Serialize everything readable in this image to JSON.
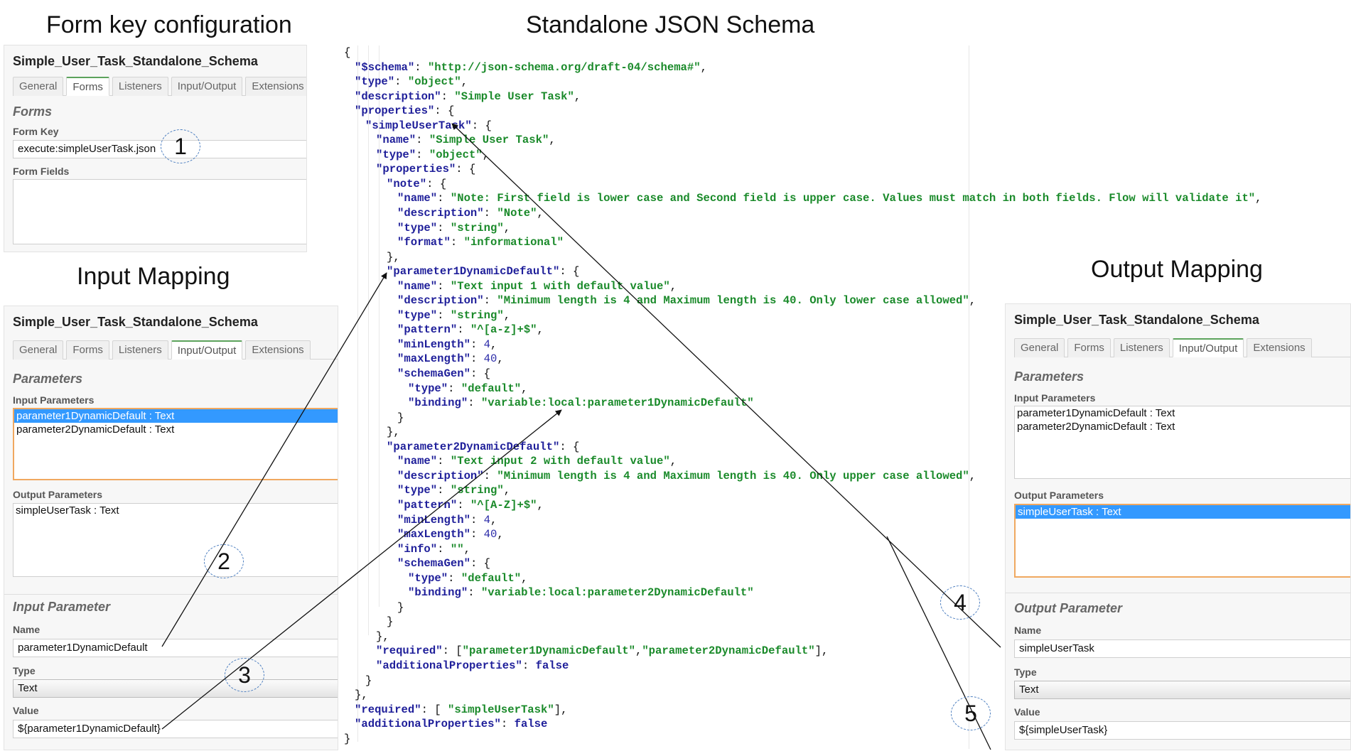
{
  "headings": {
    "form_key": "Form key configuration",
    "schema": "Standalone JSON Schema",
    "input_mapping": "Input Mapping",
    "output_mapping": "Output Mapping"
  },
  "panel_title": "Simple_User_Task_Standalone_Schema",
  "tabs": [
    "General",
    "Forms",
    "Listeners",
    "Input/Output",
    "Extensions"
  ],
  "forms_panel": {
    "active_tab": "Forms",
    "section": "Forms",
    "form_key_label": "Form Key",
    "form_key_value": "execute:simpleUserTask.json",
    "form_fields_label": "Form Fields"
  },
  "input_panel": {
    "active_tab": "Input/Output",
    "section": "Parameters",
    "input_params_label": "Input Parameters",
    "input_params": [
      "parameter1DynamicDefault : Text",
      "parameter2DynamicDefault : Text"
    ],
    "output_params_label": "Output Parameters",
    "output_params": [
      "simpleUserTask : Text"
    ],
    "detail_section": "Input Parameter",
    "name_label": "Name",
    "name_value": "parameter1DynamicDefault",
    "type_label": "Type",
    "type_value": "Text",
    "value_label": "Value",
    "value_value": "${parameter1DynamicDefault}"
  },
  "output_panel": {
    "active_tab": "Input/Output",
    "section": "Parameters",
    "input_params_label": "Input Parameters",
    "input_params": [
      "parameter1DynamicDefault : Text",
      "parameter2DynamicDefault : Text"
    ],
    "output_params_label": "Output Parameters",
    "output_params": [
      "simpleUserTask : Text"
    ],
    "detail_section": "Output Parameter",
    "name_label": "Name",
    "name_value": "simpleUserTask",
    "type_label": "Type",
    "type_value": "Text",
    "value_label": "Value",
    "value_value": "${simpleUserTask}"
  },
  "callouts": [
    "1",
    "2",
    "3",
    "4",
    "5"
  ],
  "schema_lines": [
    [
      0,
      [
        [
          "p",
          "{"
        ]
      ]
    ],
    [
      1,
      [
        [
          "k",
          "\"$schema\""
        ],
        [
          "p",
          ": "
        ],
        [
          "s",
          "\"http://json-schema.org/draft-04/schema#\""
        ],
        [
          "p",
          ","
        ]
      ]
    ],
    [
      1,
      [
        [
          "k",
          "\"type\""
        ],
        [
          "p",
          ": "
        ],
        [
          "s",
          "\"object\""
        ],
        [
          "p",
          ","
        ]
      ]
    ],
    [
      1,
      [
        [
          "k",
          "\"description\""
        ],
        [
          "p",
          ": "
        ],
        [
          "s",
          "\"Simple User Task\""
        ],
        [
          "p",
          ","
        ]
      ]
    ],
    [
      1,
      [
        [
          "k",
          "\"properties\""
        ],
        [
          "p",
          ": {"
        ]
      ]
    ],
    [
      2,
      [
        [
          "k",
          "\"simpleUserTask\""
        ],
        [
          "p",
          ": {"
        ]
      ]
    ],
    [
      3,
      [
        [
          "k",
          "\"name\""
        ],
        [
          "p",
          ": "
        ],
        [
          "s",
          "\"Simple User Task\""
        ],
        [
          "p",
          ","
        ]
      ]
    ],
    [
      3,
      [
        [
          "k",
          "\"type\""
        ],
        [
          "p",
          ": "
        ],
        [
          "s",
          "\"object\""
        ],
        [
          "p",
          ","
        ]
      ]
    ],
    [
      3,
      [
        [
          "k",
          "\"properties\""
        ],
        [
          "p",
          ": {"
        ]
      ]
    ],
    [
      4,
      [
        [
          "k",
          "\"note\""
        ],
        [
          "p",
          ": {"
        ]
      ]
    ],
    [
      5,
      [
        [
          "k",
          "\"name\""
        ],
        [
          "p",
          ": "
        ],
        [
          "s",
          "\"Note: First field is lower case and Second field is upper case. Values must match in both fields. Flow will validate it\""
        ],
        [
          "p",
          ","
        ]
      ]
    ],
    [
      5,
      [
        [
          "k",
          "\"description\""
        ],
        [
          "p",
          ": "
        ],
        [
          "s",
          "\"Note\""
        ],
        [
          "p",
          ","
        ]
      ]
    ],
    [
      5,
      [
        [
          "k",
          "\"type\""
        ],
        [
          "p",
          ": "
        ],
        [
          "s",
          "\"string\""
        ],
        [
          "p",
          ","
        ]
      ]
    ],
    [
      5,
      [
        [
          "k",
          "\"format\""
        ],
        [
          "p",
          ": "
        ],
        [
          "s",
          "\"informational\""
        ]
      ]
    ],
    [
      4,
      [
        [
          "p",
          "},"
        ]
      ]
    ],
    [
      4,
      [
        [
          "k",
          "\"parameter1DynamicDefault\""
        ],
        [
          "p",
          ": {"
        ]
      ]
    ],
    [
      5,
      [
        [
          "k",
          "\"name\""
        ],
        [
          "p",
          ": "
        ],
        [
          "s",
          "\"Text input 1 with default value\""
        ],
        [
          "p",
          ","
        ]
      ]
    ],
    [
      5,
      [
        [
          "k",
          "\"description\""
        ],
        [
          "p",
          ": "
        ],
        [
          "s",
          "\"Minimum length is 4 and Maximum length is 40. Only lower case allowed\""
        ],
        [
          "p",
          ","
        ]
      ]
    ],
    [
      5,
      [
        [
          "k",
          "\"type\""
        ],
        [
          "p",
          ": "
        ],
        [
          "s",
          "\"string\""
        ],
        [
          "p",
          ","
        ]
      ]
    ],
    [
      5,
      [
        [
          "k",
          "\"pattern\""
        ],
        [
          "p",
          ": "
        ],
        [
          "s",
          "\"^[a-z]+$\""
        ],
        [
          "p",
          ","
        ]
      ]
    ],
    [
      5,
      [
        [
          "k",
          "\"minLength\""
        ],
        [
          "p",
          ": "
        ],
        [
          "n",
          "4"
        ],
        [
          "p",
          ","
        ]
      ]
    ],
    [
      5,
      [
        [
          "k",
          "\"maxLength\""
        ],
        [
          "p",
          ": "
        ],
        [
          "n",
          "40"
        ],
        [
          "p",
          ","
        ]
      ]
    ],
    [
      5,
      [
        [
          "k",
          "\"schemaGen\""
        ],
        [
          "p",
          ": {"
        ]
      ]
    ],
    [
      6,
      [
        [
          "k",
          "\"type\""
        ],
        [
          "p",
          ": "
        ],
        [
          "s",
          "\"default\""
        ],
        [
          "p",
          ","
        ]
      ]
    ],
    [
      6,
      [
        [
          "k",
          "\"binding\""
        ],
        [
          "p",
          ": "
        ],
        [
          "s",
          "\"variable:local:parameter1DynamicDefault\""
        ]
      ]
    ],
    [
      5,
      [
        [
          "p",
          "}"
        ]
      ]
    ],
    [
      4,
      [
        [
          "p",
          "},"
        ]
      ]
    ],
    [
      4,
      [
        [
          "k",
          "\"parameter2DynamicDefault\""
        ],
        [
          "p",
          ": {"
        ]
      ]
    ],
    [
      5,
      [
        [
          "k",
          "\"name\""
        ],
        [
          "p",
          ": "
        ],
        [
          "s",
          "\"Text input 2 with default value\""
        ],
        [
          "p",
          ","
        ]
      ]
    ],
    [
      5,
      [
        [
          "k",
          "\"description\""
        ],
        [
          "p",
          ": "
        ],
        [
          "s",
          "\"Minimum length is 4 and Maximum length is 40. Only upper case allowed\""
        ],
        [
          "p",
          ","
        ]
      ]
    ],
    [
      5,
      [
        [
          "k",
          "\"type\""
        ],
        [
          "p",
          ": "
        ],
        [
          "s",
          "\"string\""
        ],
        [
          "p",
          ","
        ]
      ]
    ],
    [
      5,
      [
        [
          "k",
          "\"pattern\""
        ],
        [
          "p",
          ": "
        ],
        [
          "s",
          "\"^[A-Z]+$\""
        ],
        [
          "p",
          ","
        ]
      ]
    ],
    [
      5,
      [
        [
          "k",
          "\"minLength\""
        ],
        [
          "p",
          ": "
        ],
        [
          "n",
          "4"
        ],
        [
          "p",
          ","
        ]
      ]
    ],
    [
      5,
      [
        [
          "k",
          "\"maxLength\""
        ],
        [
          "p",
          ": "
        ],
        [
          "n",
          "40"
        ],
        [
          "p",
          ","
        ]
      ]
    ],
    [
      5,
      [
        [
          "k",
          "\"info\""
        ],
        [
          "p",
          ": "
        ],
        [
          "s",
          "\"\""
        ],
        [
          "p",
          ","
        ]
      ]
    ],
    [
      5,
      [
        [
          "k",
          "\"schemaGen\""
        ],
        [
          "p",
          ": {"
        ]
      ]
    ],
    [
      6,
      [
        [
          "k",
          "\"type\""
        ],
        [
          "p",
          ": "
        ],
        [
          "s",
          "\"default\""
        ],
        [
          "p",
          ","
        ]
      ]
    ],
    [
      6,
      [
        [
          "k",
          "\"binding\""
        ],
        [
          "p",
          ": "
        ],
        [
          "s",
          "\"variable:local:parameter2DynamicDefault\""
        ]
      ]
    ],
    [
      5,
      [
        [
          "p",
          "}"
        ]
      ]
    ],
    [
      4,
      [
        [
          "p",
          "}"
        ]
      ]
    ],
    [
      3,
      [
        [
          "p",
          "},"
        ]
      ]
    ],
    [
      3,
      [
        [
          "k",
          "\"required\""
        ],
        [
          "p",
          ": ["
        ],
        [
          "s",
          "\"parameter1DynamicDefault\""
        ],
        [
          "p",
          ","
        ],
        [
          "s",
          "\"parameter2DynamicDefault\""
        ],
        [
          "p",
          "],"
        ]
      ]
    ],
    [
      3,
      [
        [
          "k",
          "\"additionalProperties\""
        ],
        [
          "p",
          ": "
        ],
        [
          "b",
          "false"
        ]
      ]
    ],
    [
      2,
      [
        [
          "p",
          "}"
        ]
      ]
    ],
    [
      1,
      [
        [
          "p",
          "},"
        ]
      ]
    ],
    [
      1,
      [
        [
          "k",
          "\"required\""
        ],
        [
          "p",
          ": [ "
        ],
        [
          "s",
          "\"simpleUserTask\""
        ],
        [
          "p",
          "],"
        ]
      ]
    ],
    [
      1,
      [
        [
          "k",
          "\"additionalProperties\""
        ],
        [
          "p",
          ": "
        ],
        [
          "b",
          "false"
        ]
      ]
    ],
    [
      0,
      [
        [
          "p",
          "}"
        ]
      ]
    ]
  ]
}
